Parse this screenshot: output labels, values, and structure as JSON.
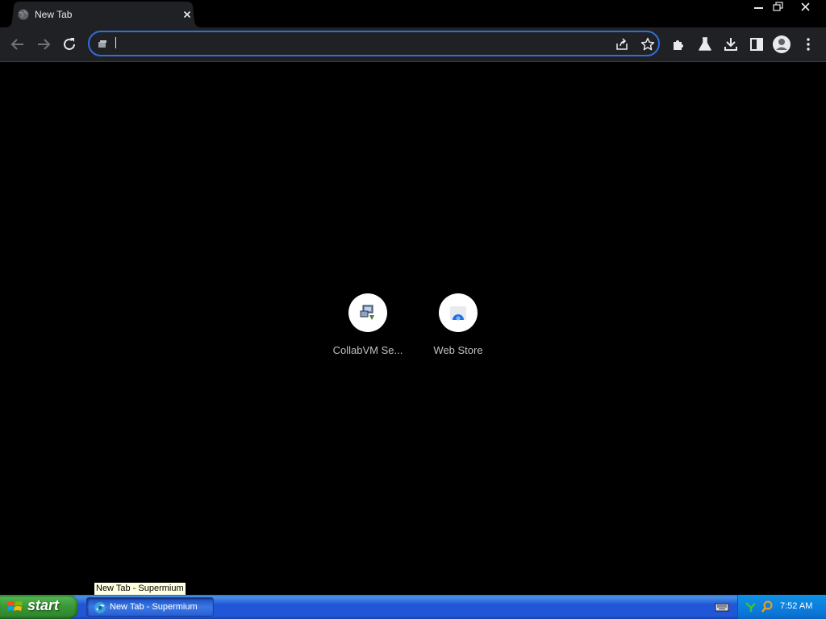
{
  "browser": {
    "tab": {
      "title": "New Tab"
    },
    "omnibox": {
      "value": "",
      "placeholder": ""
    }
  },
  "shortcuts": [
    {
      "label": "CollabVM Se..."
    },
    {
      "label": "Web Store"
    }
  ],
  "taskbar": {
    "start_label": "start",
    "task_button_label": "New Tab - Supermium",
    "tooltip": "New Tab - Supermium",
    "clock": "7:52 AM"
  },
  "colors": {
    "page_background": "#000000",
    "toolbar": "#202124",
    "omnibox_focus": "#2f6fdb",
    "taskbar_blue": "#2157d7",
    "start_green": "#3a9637"
  }
}
